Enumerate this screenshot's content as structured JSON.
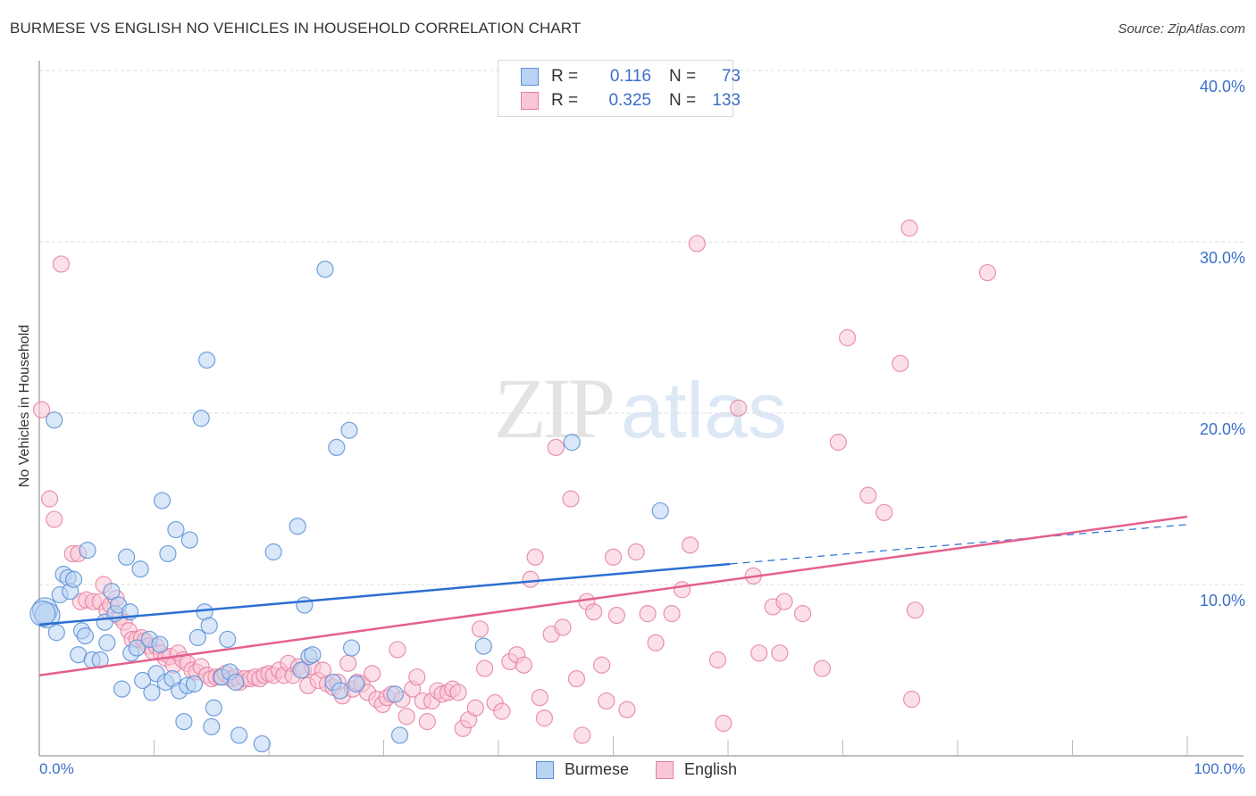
{
  "header": {
    "title": "BURMESE VS ENGLISH NO VEHICLES IN HOUSEHOLD CORRELATION CHART",
    "source": "Source: ZipAtlas.com"
  },
  "watermark": {
    "zip": "ZIP",
    "atlas": "atlas"
  },
  "colors": {
    "burmese_fill": "#b9d3f3",
    "burmese_stroke": "#5b8fd6",
    "burmese_line": "#2a6fd1",
    "english_fill": "#f9c6d6",
    "english_stroke": "#e57fa1",
    "english_line": "#e4608c",
    "tick_label": "#3a6fc9",
    "grid": "#dddddd"
  },
  "legend_top": {
    "rows": [
      {
        "series": "Burmese",
        "r_label": "R =",
        "r_value": "0.116",
        "n_label": "N =",
        "n_value": "73"
      },
      {
        "series": "English",
        "r_label": "R =",
        "r_value": "0.325",
        "n_label": "N =",
        "n_value": "133"
      }
    ]
  },
  "chart_data": {
    "type": "scatter",
    "title": "BURMESE VS ENGLISH NO VEHICLES IN HOUSEHOLD CORRELATION CHART",
    "xlabel": "",
    "ylabel": "No Vehicles in Household",
    "xlim": [
      0,
      100
    ],
    "ylim": [
      0,
      42
    ],
    "x_tick_labels": [
      "0.0%",
      "100.0%"
    ],
    "y_ticks": [
      10,
      20,
      30,
      40
    ],
    "y_tick_labels": [
      "10.0%",
      "20.0%",
      "30.0%",
      "40.0%"
    ],
    "grid": "horizontal-dashed",
    "legend": [
      "Burmese",
      "English"
    ],
    "legend_placement": "bottom-center",
    "series": [
      {
        "name": "Burmese",
        "r": 0.116,
        "n": 73,
        "trend": {
          "x0": 0,
          "y0": 7.66,
          "x1": 60.2,
          "y1": 11.2,
          "dashed_to_x": 100,
          "dashed_to_y": 13.5
        },
        "points": [
          [
            0.5,
            8.5,
            2
          ],
          [
            0.7,
            8.2,
            2
          ],
          [
            1.3,
            19.6,
            1
          ],
          [
            1.5,
            7.2
          ],
          [
            1.8,
            9.4
          ],
          [
            2.1,
            10.6
          ],
          [
            2.5,
            10.4
          ],
          [
            2.7,
            9.6
          ],
          [
            3.0,
            10.3
          ],
          [
            3.4,
            5.9
          ],
          [
            3.7,
            7.3
          ],
          [
            4.0,
            7.0
          ],
          [
            4.2,
            12.0
          ],
          [
            4.6,
            5.6
          ],
          [
            5.3,
            5.6
          ],
          [
            5.7,
            7.8
          ],
          [
            5.9,
            6.6
          ],
          [
            6.3,
            9.6
          ],
          [
            6.6,
            8.3
          ],
          [
            6.9,
            8.8
          ],
          [
            7.2,
            3.9
          ],
          [
            7.6,
            11.6
          ],
          [
            7.9,
            8.4
          ],
          [
            8.0,
            6.0
          ],
          [
            8.5,
            6.3
          ],
          [
            8.8,
            10.9
          ],
          [
            9.0,
            4.4
          ],
          [
            9.6,
            6.8
          ],
          [
            9.8,
            3.7
          ],
          [
            10.2,
            4.8
          ],
          [
            10.5,
            6.5
          ],
          [
            10.7,
            14.9
          ],
          [
            11.0,
            4.3
          ],
          [
            11.2,
            11.8
          ],
          [
            11.6,
            4.5
          ],
          [
            11.9,
            13.2
          ],
          [
            12.2,
            3.8
          ],
          [
            12.6,
            2.0
          ],
          [
            12.9,
            4.1
          ],
          [
            13.1,
            12.6
          ],
          [
            13.5,
            4.2
          ],
          [
            13.8,
            6.9
          ],
          [
            14.1,
            19.7
          ],
          [
            14.4,
            8.4
          ],
          [
            14.6,
            23.1
          ],
          [
            14.8,
            7.6
          ],
          [
            15.2,
            2.8
          ],
          [
            15.0,
            1.7
          ],
          [
            15.9,
            4.6
          ],
          [
            16.4,
            6.8
          ],
          [
            16.6,
            4.9
          ],
          [
            17.1,
            4.3
          ],
          [
            17.4,
            1.2
          ],
          [
            19.4,
            0.7
          ],
          [
            20.4,
            11.9
          ],
          [
            22.8,
            5.0
          ],
          [
            22.5,
            13.4
          ],
          [
            23.1,
            8.8
          ],
          [
            23.5,
            5.8
          ],
          [
            23.8,
            5.9
          ],
          [
            24.9,
            28.4
          ],
          [
            25.6,
            4.3
          ],
          [
            25.9,
            18.0
          ],
          [
            26.2,
            3.8
          ],
          [
            27.0,
            19.0
          ],
          [
            27.2,
            6.3
          ],
          [
            27.6,
            4.2
          ],
          [
            31.0,
            3.6
          ],
          [
            31.4,
            1.2
          ],
          [
            38.7,
            6.4
          ],
          [
            46.4,
            18.3
          ],
          [
            54.1,
            14.3
          ],
          [
            0.3,
            8.3,
            2
          ]
        ]
      },
      {
        "name": "English",
        "r": 0.325,
        "n": 133,
        "trend": {
          "x0": 0,
          "y0": 4.7,
          "x1": 100,
          "y1": 13.96
        },
        "points": [
          [
            0.2,
            20.2
          ],
          [
            0.9,
            15.0
          ],
          [
            1.3,
            13.8
          ],
          [
            1.9,
            28.7
          ],
          [
            2.9,
            11.8
          ],
          [
            3.4,
            11.8
          ],
          [
            3.6,
            9.0
          ],
          [
            4.1,
            9.1
          ],
          [
            4.7,
            9.0
          ],
          [
            5.3,
            9.0
          ],
          [
            5.6,
            10.0
          ],
          [
            5.9,
            8.5
          ],
          [
            6.2,
            8.8
          ],
          [
            6.7,
            9.2
          ],
          [
            7.0,
            8.1
          ],
          [
            7.4,
            7.8
          ],
          [
            7.8,
            7.3
          ],
          [
            8.1,
            6.8
          ],
          [
            8.5,
            6.8
          ],
          [
            8.9,
            6.9
          ],
          [
            9.2,
            6.7
          ],
          [
            9.5,
            6.4
          ],
          [
            9.9,
            6.1
          ],
          [
            10.2,
            6.4
          ],
          [
            10.6,
            6.0
          ],
          [
            11.0,
            5.7
          ],
          [
            11.4,
            5.8
          ],
          [
            11.7,
            5.3
          ],
          [
            12.1,
            6.0
          ],
          [
            12.5,
            5.6
          ],
          [
            12.9,
            5.4
          ],
          [
            13.3,
            5.0
          ],
          [
            13.7,
            4.9
          ],
          [
            14.1,
            5.2
          ],
          [
            14.6,
            4.7
          ],
          [
            15.0,
            4.5
          ],
          [
            15.4,
            4.6
          ],
          [
            15.8,
            4.6
          ],
          [
            16.2,
            4.8
          ],
          [
            16.7,
            4.5
          ],
          [
            17.1,
            4.6
          ],
          [
            17.5,
            4.3
          ],
          [
            17.9,
            4.5
          ],
          [
            18.4,
            4.5
          ],
          [
            18.8,
            4.6
          ],
          [
            19.2,
            4.5
          ],
          [
            19.6,
            4.7
          ],
          [
            20.0,
            4.8
          ],
          [
            20.4,
            4.7
          ],
          [
            20.9,
            5.0
          ],
          [
            21.3,
            4.7
          ],
          [
            21.7,
            5.4
          ],
          [
            22.1,
            4.7
          ],
          [
            22.6,
            5.2
          ],
          [
            23.0,
            5.0
          ],
          [
            23.4,
            4.1
          ],
          [
            23.8,
            5.2
          ],
          [
            24.3,
            4.4
          ],
          [
            24.7,
            5.0
          ],
          [
            25.1,
            4.2
          ],
          [
            25.6,
            4.0
          ],
          [
            26.0,
            4.3
          ],
          [
            26.4,
            3.5
          ],
          [
            26.9,
            5.4
          ],
          [
            27.3,
            3.9
          ],
          [
            27.7,
            4.3
          ],
          [
            28.1,
            4.2
          ],
          [
            28.6,
            3.7
          ],
          [
            29.0,
            4.8
          ],
          [
            29.4,
            3.3
          ],
          [
            29.9,
            3.0
          ],
          [
            30.3,
            3.4
          ],
          [
            30.7,
            3.6
          ],
          [
            31.2,
            6.2
          ],
          [
            31.6,
            3.3
          ],
          [
            32.0,
            2.3
          ],
          [
            32.5,
            3.9
          ],
          [
            32.9,
            4.6
          ],
          [
            33.4,
            3.2
          ],
          [
            33.8,
            2.0
          ],
          [
            34.2,
            3.2
          ],
          [
            34.7,
            3.8
          ],
          [
            35.1,
            3.6
          ],
          [
            35.6,
            3.7
          ],
          [
            36.0,
            3.9
          ],
          [
            36.5,
            3.7
          ],
          [
            36.9,
            1.6
          ],
          [
            37.4,
            2.1
          ],
          [
            38.0,
            2.8
          ],
          [
            38.4,
            7.4
          ],
          [
            38.8,
            5.1
          ],
          [
            39.7,
            3.1
          ],
          [
            40.3,
            2.6
          ],
          [
            41.0,
            5.5
          ],
          [
            41.6,
            5.9
          ],
          [
            42.2,
            5.3
          ],
          [
            42.8,
            10.3
          ],
          [
            43.2,
            11.6
          ],
          [
            43.6,
            3.4
          ],
          [
            44.0,
            2.2
          ],
          [
            44.6,
            7.1
          ],
          [
            45.0,
            18.0
          ],
          [
            45.6,
            7.5
          ],
          [
            46.3,
            15.0
          ],
          [
            46.8,
            4.5
          ],
          [
            47.3,
            1.2
          ],
          [
            47.7,
            9.0
          ],
          [
            48.3,
            8.4
          ],
          [
            49.0,
            5.3
          ],
          [
            49.4,
            3.2
          ],
          [
            50.0,
            11.6
          ],
          [
            50.3,
            8.2
          ],
          [
            51.2,
            2.7
          ],
          [
            52.0,
            11.9
          ],
          [
            53.0,
            8.3
          ],
          [
            53.7,
            6.6
          ],
          [
            55.1,
            8.3
          ],
          [
            56.0,
            9.7
          ],
          [
            56.7,
            12.3
          ],
          [
            57.3,
            29.9
          ],
          [
            59.1,
            5.6
          ],
          [
            59.6,
            1.9
          ],
          [
            60.9,
            20.3
          ],
          [
            62.2,
            10.5
          ],
          [
            62.7,
            6.0
          ],
          [
            64.5,
            6.0
          ],
          [
            63.9,
            8.7
          ],
          [
            64.9,
            9.0
          ],
          [
            66.5,
            8.3
          ],
          [
            68.2,
            5.1
          ],
          [
            69.6,
            18.3
          ],
          [
            70.4,
            24.4
          ],
          [
            72.2,
            15.2
          ],
          [
            73.6,
            14.2
          ],
          [
            75.0,
            22.9
          ],
          [
            75.8,
            30.8
          ],
          [
            76.0,
            3.3
          ],
          [
            76.3,
            8.5
          ],
          [
            82.6,
            28.2
          ]
        ]
      }
    ]
  },
  "legend_bottom": {
    "items": [
      {
        "label": "Burmese"
      },
      {
        "label": "English"
      }
    ]
  },
  "axis": {
    "y_label": "No Vehicles in Household",
    "x_min_label": "0.0%",
    "x_max_label": "100.0%"
  }
}
